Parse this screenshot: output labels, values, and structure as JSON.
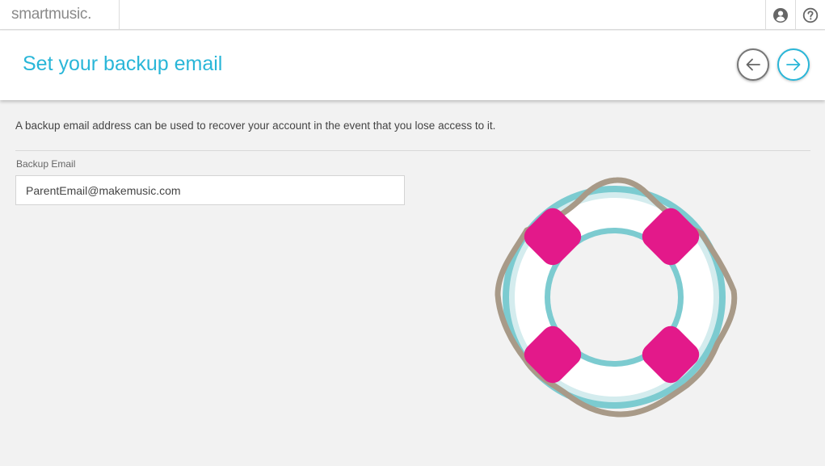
{
  "app": {
    "logo_text": "smartmusic."
  },
  "topbar": {
    "icons": [
      "user-icon",
      "help-icon"
    ]
  },
  "header": {
    "title": "Set your backup email",
    "back_icon": "arrow-left-icon",
    "next_icon": "arrow-right-icon"
  },
  "main": {
    "description": "A backup email address can be used to recover your account in the event that you lose access to it.",
    "field_label": "Backup Email",
    "email_value": "ParentEmail@makemusic.com",
    "illustration": "life-ring-icon"
  },
  "colors": {
    "accent": "#29b6d8",
    "ring_teal": "#7ccbd0",
    "ring_pink": "#e3198a",
    "rope": "#a89a88",
    "background": "#f2f2f2"
  }
}
